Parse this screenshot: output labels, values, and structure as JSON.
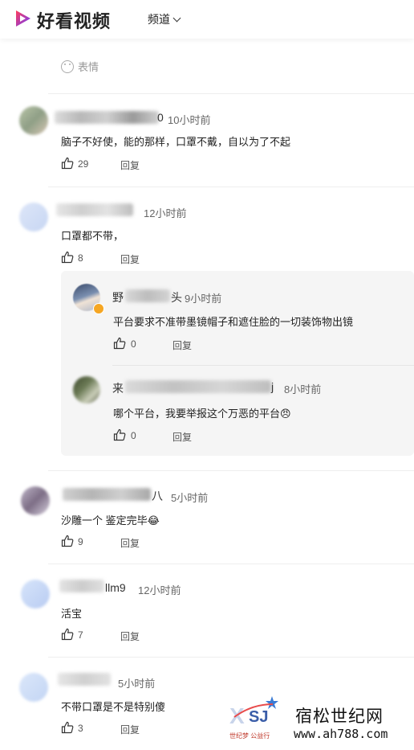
{
  "header": {
    "brand": "好看视频",
    "channel_label": "频道"
  },
  "emoji_label": "表情",
  "reply_label": "回复",
  "comments": [
    {
      "name_suffix": "0",
      "time": "10小时前",
      "text": "脑子不好使，能的那样，口罩不戴，自以为了不起",
      "likes": "29"
    },
    {
      "name_suffix": "",
      "time": "12小时前",
      "text": "口罩都不带，",
      "likes": "8"
    },
    {
      "name_suffix": "八",
      "time": "5小时前",
      "text": "沙雕一个  鉴定完毕😂",
      "likes": "9"
    },
    {
      "name_suffix": "llm9",
      "time": "12小时前",
      "text": "活宝",
      "likes": "7"
    },
    {
      "name_suffix": "",
      "time": "5小时前",
      "text": "不带口罩是不是特别傻",
      "likes": "3"
    }
  ],
  "replies": [
    {
      "name_prefix": "野",
      "name_suffix": "头",
      "time": "9小时前",
      "text": "平台要求不准带墨镜帽子和遮住脸的一切装饰物出镜",
      "likes": "0"
    },
    {
      "name_prefix": "来",
      "name_suffix": "j",
      "time": "8小时前",
      "text": "哪个平台，我要举报这个万恶的平台😠",
      "likes": "0"
    }
  ],
  "watermark": {
    "title": "宿松世纪网",
    "url": "www.ah788.com",
    "sub": "世纪梦 公益行"
  },
  "colors": {
    "brand_purple": "#6b3cff",
    "brand_red": "#ff3d5a",
    "badge_orange": "#f5a623"
  }
}
